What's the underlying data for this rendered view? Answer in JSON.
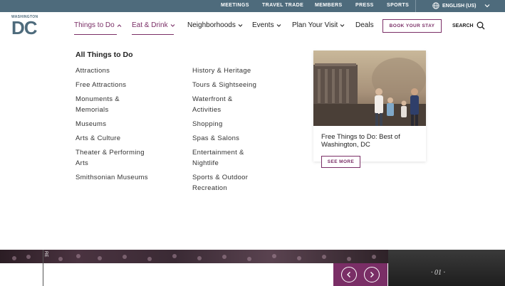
{
  "utility_nav": {
    "items": [
      "MEETINGS",
      "TRAVEL TRADE",
      "MEMBERS",
      "PRESS",
      "SPORTS"
    ],
    "language": "ENGLISH (US)"
  },
  "logo": {
    "small": "WASHINGTON",
    "big": "DC"
  },
  "main_nav": {
    "items": [
      "Things to Do",
      "Eat & Drink",
      "Neighborhoods",
      "Events",
      "Plan Your Visit",
      "Deals"
    ],
    "book_label": "BOOK YOUR STAY",
    "search_label": "SEARCH"
  },
  "mega_menu": {
    "heading": "All Things to Do",
    "col1": [
      "Attractions",
      "Free Attractions",
      "Monuments & Memorials",
      "Museums",
      "Arts & Culture",
      "Theater & Performing Arts",
      "Smithsonian Museums"
    ],
    "col2": [
      "History & Heritage",
      "Tours & Sightseeing",
      "Waterfront & Activities",
      "Shopping",
      "Spas & Salons",
      "Entertainment & Nightlife",
      "Sports & Outdoor Recreation"
    ],
    "card": {
      "title": "Free Things to Do: Best of Washington, DC",
      "button": "SEE MORE"
    }
  },
  "bottom": {
    "counter": "01",
    "vertical_text": "RE"
  },
  "colors": {
    "utility_bg": "#4e6b7c",
    "accent": "#7a2e66"
  }
}
